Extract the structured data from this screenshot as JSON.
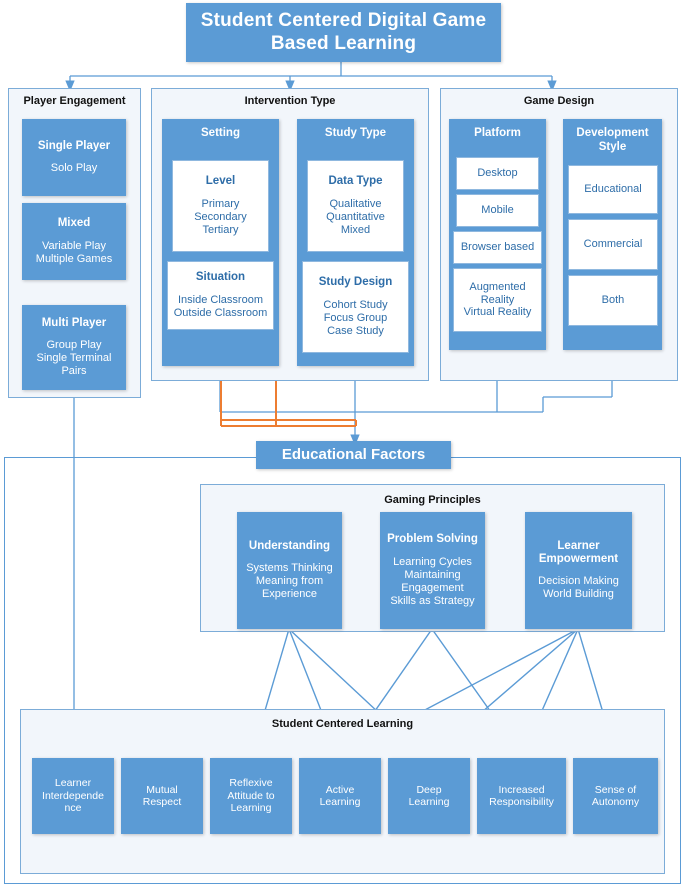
{
  "title": {
    "line1": "Student Centered Digital Game",
    "line2": "Based Learning"
  },
  "colors": {
    "accent_blue": "#5B9BD5",
    "panel_border": "#7CACD8",
    "panel_fill": "#F2F6FB",
    "blue_text": "#2E6DA8",
    "orange_connector": "#ED7D31",
    "white": "#FFFFFF"
  },
  "columns": [
    {
      "header": "Player Engagement",
      "cards": [
        {
          "title": "Single Player",
          "items": [
            "Solo Play"
          ]
        },
        {
          "title": "Mixed",
          "items": [
            "Variable Play",
            "Multiple Games"
          ]
        },
        {
          "title": "Multi Player",
          "items": [
            "Group Play",
            "Single Terminal",
            "Pairs"
          ]
        }
      ]
    },
    {
      "header": "Intervention Type",
      "groups": [
        {
          "title": "Setting",
          "cards": [
            {
              "title": "Level",
              "items": [
                "Primary",
                "Secondary",
                "Tertiary"
              ]
            },
            {
              "title": "Situation",
              "items": [
                "Inside Classroom",
                "Outside Classroom"
              ]
            }
          ]
        },
        {
          "title": "Study Type",
          "cards": [
            {
              "title": "Data Type",
              "items": [
                "Qualitative",
                "Quantitative",
                "Mixed"
              ]
            },
            {
              "title": "Study Design",
              "items": [
                "Cohort Study",
                "Focus Group",
                "Case Study"
              ]
            }
          ]
        }
      ]
    },
    {
      "header": "Game Design",
      "groups": [
        {
          "title": "Platform",
          "cards": [
            {
              "title": "",
              "items": [
                "Desktop"
              ]
            },
            {
              "title": "",
              "items": [
                "Mobile"
              ]
            },
            {
              "title": "",
              "items": [
                "Browser based"
              ]
            },
            {
              "title": "",
              "items": [
                "Augmented",
                "Reality",
                "Virtual Reality"
              ]
            }
          ]
        },
        {
          "title": "Development Style",
          "title_line1": "Development",
          "title_line2": "Style",
          "cards": [
            {
              "title": "",
              "items": [
                "Educational"
              ]
            },
            {
              "title": "",
              "items": [
                "Commercial"
              ]
            },
            {
              "title": "",
              "items": [
                "Both"
              ]
            }
          ]
        }
      ]
    }
  ],
  "educational_factors": {
    "banner": "Educational Factors",
    "gaming_principles": {
      "header": "Gaming Principles",
      "cards": [
        {
          "title": "Understanding",
          "items": [
            "Systems Thinking",
            "Meaning from",
            "Experience"
          ]
        },
        {
          "title": "Problem Solving",
          "items": [
            "Learning Cycles",
            "Maintaining",
            "Engagement",
            "Skills as Strategy"
          ]
        },
        {
          "title_line1": "Learner",
          "title_line2": "Empowerment",
          "title": "Learner Empowerment",
          "items": [
            "Decision Making",
            "World Building"
          ]
        }
      ]
    },
    "student_centered_learning": {
      "header": "Student Centered Learning",
      "outcomes": [
        {
          "lines": [
            "Learner",
            "Interdepende",
            "nce"
          ]
        },
        {
          "lines": [
            "Mutual",
            "Respect"
          ]
        },
        {
          "lines": [
            "Reflexive",
            "Attitude to",
            "Learning"
          ]
        },
        {
          "lines": [
            "Active",
            "Learning"
          ]
        },
        {
          "lines": [
            "Deep",
            "Learning"
          ]
        },
        {
          "lines": [
            "Increased",
            "Responsibility"
          ]
        },
        {
          "lines": [
            "Sense of",
            "Autonomy"
          ]
        }
      ]
    }
  }
}
